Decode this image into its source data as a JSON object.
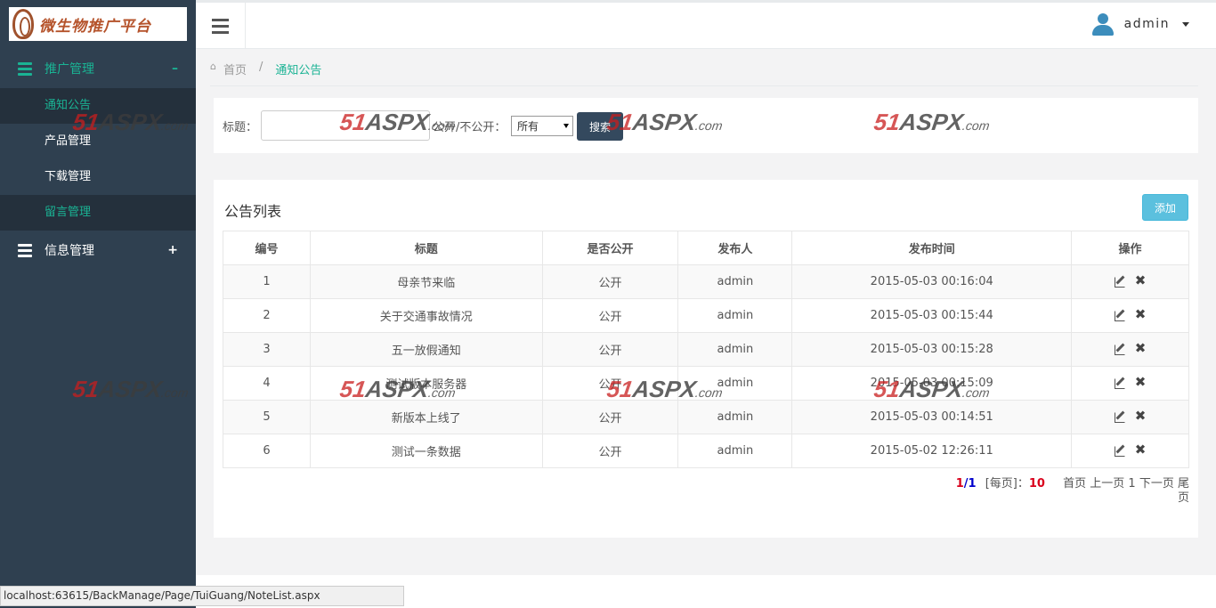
{
  "logo": {
    "text": "微生物推广平台"
  },
  "sidebar": {
    "groups": [
      {
        "label": "推广管理",
        "toggle": "–",
        "items": [
          {
            "label": "通知公告"
          },
          {
            "label": "产品管理"
          },
          {
            "label": "下载管理"
          },
          {
            "label": "留言管理"
          }
        ]
      },
      {
        "label": "信息管理",
        "toggle": "+"
      }
    ]
  },
  "topbar": {
    "user": "admin"
  },
  "breadcrumb": {
    "home": "首页",
    "sep": "/",
    "current": "通知公告"
  },
  "search": {
    "title_label": "标题：",
    "title_value": "",
    "public_label": "公开/不公开：",
    "public_selected": "所有",
    "search_button": "搜索"
  },
  "list": {
    "title": "公告列表",
    "add_button": "添加",
    "columns": [
      "编号",
      "标题",
      "是否公开",
      "发布人",
      "发布时间",
      "操作"
    ],
    "rows": [
      {
        "id": "1",
        "title": "母亲节来临",
        "public": "公开",
        "author": "admin",
        "time": "2015-05-03 00:16:04"
      },
      {
        "id": "2",
        "title": "关于交通事故情况",
        "public": "公开",
        "author": "admin",
        "time": "2015-05-03 00:15:44"
      },
      {
        "id": "3",
        "title": "五一放假通知",
        "public": "公开",
        "author": "admin",
        "time": "2015-05-03 00:15:28"
      },
      {
        "id": "4",
        "title": "测试版本服务器",
        "public": "公开",
        "author": "admin",
        "time": "2015-05-03 00:15:09"
      },
      {
        "id": "5",
        "title": "新版本上线了",
        "public": "公开",
        "author": "admin",
        "time": "2015-05-03 00:14:51"
      },
      {
        "id": "6",
        "title": "测试一条数据",
        "public": "公开",
        "author": "admin",
        "time": "2015-05-02 12:26:11"
      }
    ]
  },
  "pager": {
    "current": "1",
    "slash": "/",
    "total": "1",
    "per_page_label": "[每页]：",
    "per_page": "10",
    "first": "首页",
    "prev": "上一页",
    "page": "1",
    "next": "下一页",
    "last": "尾页"
  },
  "status_bar": {
    "url": "localhost:63615/BackManage/Page/TuiGuang/NoteList.aspx"
  },
  "watermark": {
    "num": "51",
    "brand": "ASPX",
    "suffix": ".com"
  }
}
